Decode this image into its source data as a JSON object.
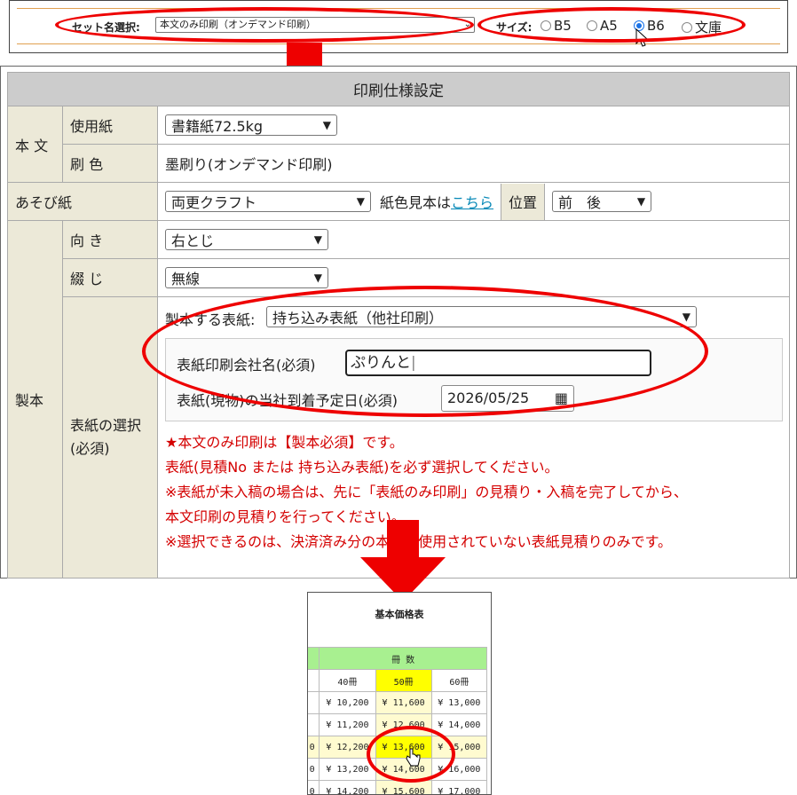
{
  "top_bar": {
    "set_label": "セット名選択:",
    "set_value": "本文のみ印刷（オンデマンド印刷）",
    "size_label": "サイズ:",
    "sizes": [
      "B5",
      "A5",
      "B6",
      "文庫"
    ],
    "selected_size": "B6"
  },
  "spec": {
    "title": "印刷仕様設定",
    "honbun_label": "本 文",
    "paper_label": "使用紙",
    "paper_value": "書籍紙72.5kg",
    "ink_label": "刷 色",
    "ink_value": "墨刷り(オンデマンド印刷)",
    "asobi_label": "あそび紙",
    "asobi_value": "両更クラフト",
    "swatch_text": "紙色見本は",
    "swatch_link": "こちら",
    "position_label": "位置",
    "position_value": "前　後",
    "seihon_label": "製本",
    "direction_label": "向 き",
    "direction_value": "右とじ",
    "binding_label": "綴 じ",
    "binding_value": "無線",
    "cover_label_1": "表紙の選択",
    "cover_label_2": "(必須)",
    "cover_sel_label": "製本する表紙:",
    "cover_sel_value": "持ち込み表紙（他社印刷）",
    "company_label": "表紙印刷会社名(必須)",
    "company_value": "ぷりんと",
    "arrival_label": "表紙(現物)の当社到着予定日(必須)",
    "arrival_value": "2026/05/25",
    "notes": [
      "★本文のみ印刷は【製本必須】です。",
      "表紙(見積No または 持ち込み表紙)を必ず選択してください。",
      "※表紙が未入稿の場合は、先に「表紙のみ印刷」の見積り・入稿を完了してから、",
      "本文印刷の見積りを行ってください。",
      "※選択できるのは、決済済み分の本文に使用されていない表紙見積りのみです。"
    ]
  },
  "price_table": {
    "title": "基本価格表",
    "group_header": "冊 数",
    "columns": [
      "40冊",
      "50冊",
      "60冊"
    ],
    "rows": [
      [
        "¥ 10,200",
        "¥ 11,600",
        "¥ 13,000"
      ],
      [
        "¥ 11,200",
        "¥ 12,600",
        "¥ 14,000"
      ],
      [
        "¥ 12,200",
        "¥ 13,600",
        "¥ 15,000"
      ],
      [
        "¥ 13,200",
        "¥ 14,600",
        "¥ 16,000"
      ],
      [
        "¥ 14,200",
        "¥ 15,600",
        "¥ 17,000"
      ]
    ]
  },
  "colors": {
    "highlight": "#ff0000",
    "accent_yellow": "#ffff00",
    "header_green": "#a8f090"
  }
}
